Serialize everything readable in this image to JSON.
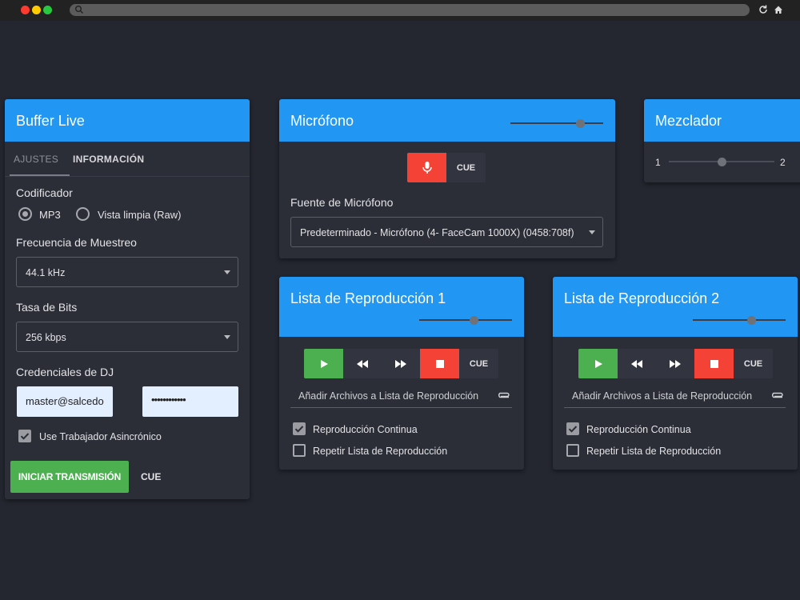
{
  "buffer": {
    "title": "Buffer Live",
    "tabs": [
      "AJUSTES",
      "INFORMACIÓN"
    ],
    "encoder_label": "Codificador",
    "encoder_options": [
      "MP3",
      "Vista limpia (Raw)"
    ],
    "encoder_selected": "MP3",
    "sample_rate_label": "Frecuencia de Muestreo",
    "sample_rate_value": "44.1 kHz",
    "bitrate_label": "Tasa de Bits",
    "bitrate_value": "256 kbps",
    "credentials_label": "Credenciales de DJ",
    "username_value": "master@salcedo",
    "password_value": "••••••••••••",
    "async_worker_label": "Use Trabajador Asincrónico",
    "async_worker_checked": true,
    "start_button": "INICIAR TRANSMISIÓN",
    "cue_button": "CUE"
  },
  "mic": {
    "title": "Micrófono",
    "volume": 0.78,
    "cue_button": "CUE",
    "source_label": "Fuente de Micrófono",
    "source_value": "Predeterminado - Micrófono (4- FaceCam 1000X) (0458:708f)"
  },
  "mixer": {
    "title": "Mezclador",
    "left_label": "1",
    "right_label": "2",
    "crossfade": 0.5
  },
  "playlists": [
    {
      "title": "Lista de Reproducción 1",
      "volume": 0.6,
      "cue_button": "CUE",
      "add_files": "Añadir Archivos a Lista de Reproducción",
      "continuous_label": "Reproducción Continua",
      "continuous_checked": true,
      "repeat_label": "Repetir Lista de Reproducción",
      "repeat_checked": false
    },
    {
      "title": "Lista de Reproducción 2",
      "volume": 0.65,
      "cue_button": "CUE",
      "add_files": "Añadir Archivos a Lista de Reproducción",
      "continuous_label": "Reproducción Continua",
      "continuous_checked": true,
      "repeat_label": "Repetir Lista de Reproducción",
      "repeat_checked": false
    }
  ],
  "colors": {
    "accent": "#2196f3",
    "play": "#4caf50",
    "stop": "#f44336",
    "background": "#242630",
    "card": "#2b2e37"
  }
}
